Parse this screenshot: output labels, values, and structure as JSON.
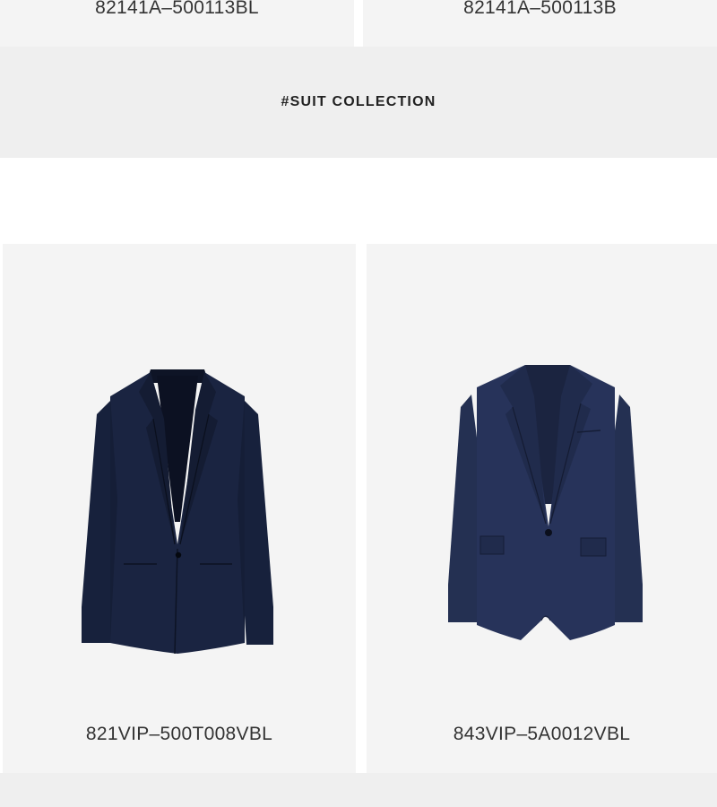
{
  "top_products": [
    {
      "sku": "82141A–500113BL"
    },
    {
      "sku": "82141A–500113B"
    }
  ],
  "banner": {
    "title": "#SUIT COLLECTION"
  },
  "products": [
    {
      "sku": "821VIP–500T008VBL",
      "image_icon": "navy-blazer-image",
      "color": "#16203a"
    },
    {
      "sku": "843VIP–5A0012VBL",
      "image_icon": "navy-blazer-image",
      "color": "#1e2845"
    }
  ]
}
